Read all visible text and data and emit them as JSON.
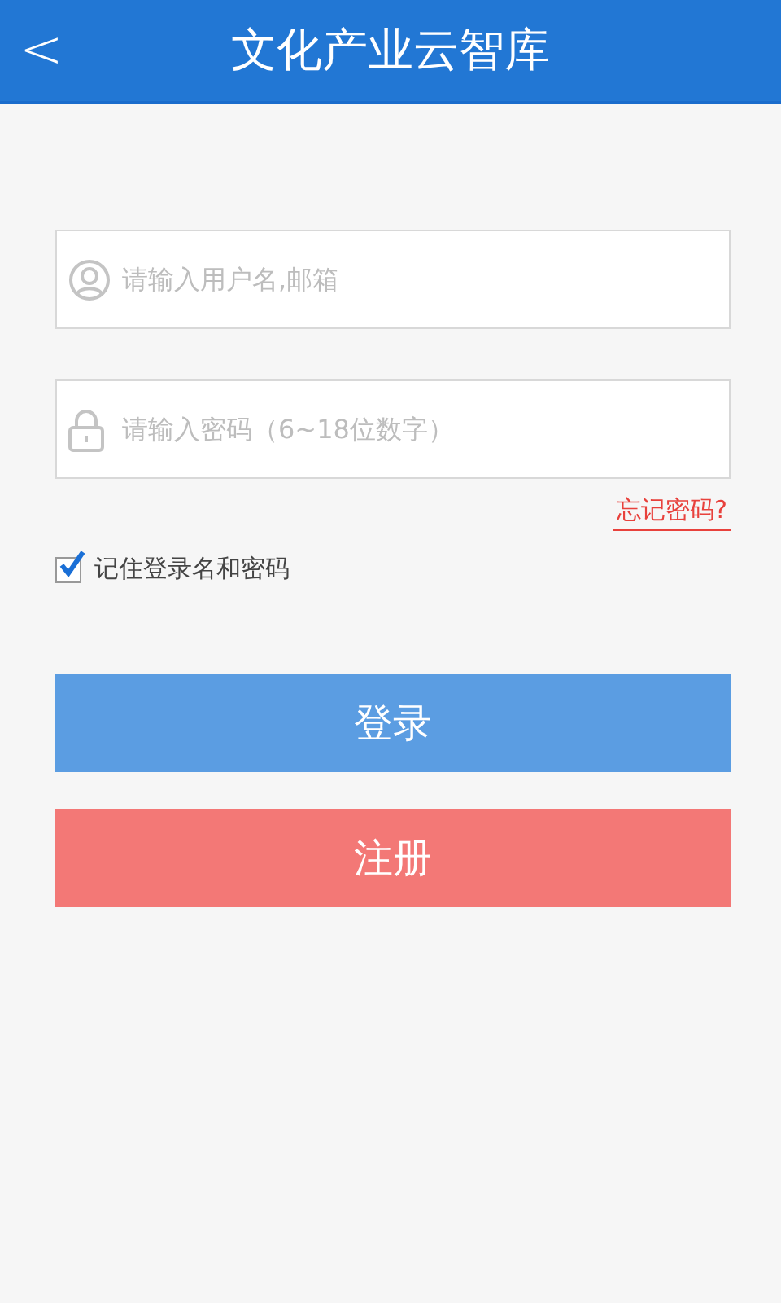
{
  "header": {
    "back_icon": "<",
    "title": "文化产业云智库"
  },
  "fields": [
    {
      "kind": "user",
      "placeholder": "请输入用户名,邮箱"
    },
    {
      "kind": "lock",
      "placeholder": "请输入密码（6~18位数字）"
    }
  ],
  "forgot_link": "忘记密码?",
  "remember": {
    "label": "记住登录名和密码",
    "checked": true
  },
  "buttons": [
    {
      "kind": "primary",
      "label": "登录"
    },
    {
      "kind": "danger",
      "label": "注册"
    }
  ]
}
